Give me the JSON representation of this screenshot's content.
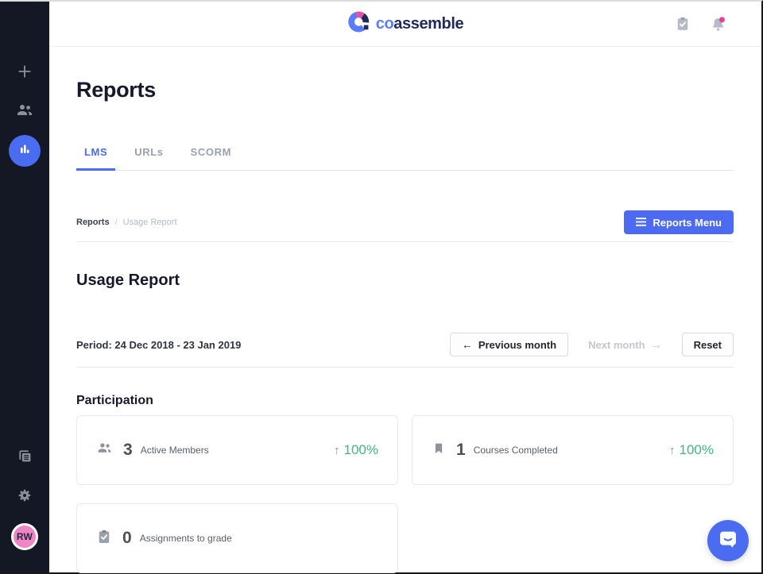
{
  "colors": {
    "accent_blue": "#4d6bf2",
    "logo_blue": "#5b7dfb",
    "navy": "#1f2a5c",
    "logo_pink": "#ed4d9e",
    "avatar_pink": "#ef85c5",
    "green": "#3fb884",
    "sidebar_bg": "#131824"
  },
  "sidebar": {
    "items": [
      {
        "name": "add",
        "icon": "plus-icon"
      },
      {
        "name": "members",
        "icon": "people-icon"
      },
      {
        "name": "reports",
        "icon": "bar-chart-icon",
        "active": true
      }
    ],
    "bottom_items": [
      {
        "name": "library",
        "icon": "stacked-pages-icon"
      },
      {
        "name": "settings",
        "icon": "gear-icon"
      }
    ],
    "avatar_initials": "RW"
  },
  "header": {
    "logo": {
      "co": "co",
      "assemble": "assemble"
    },
    "icons": [
      "clipboard-check-icon",
      "bell-icon"
    ],
    "bell_has_notification": true
  },
  "page": {
    "title": "Reports",
    "tabs": [
      {
        "label": "LMS",
        "active": true
      },
      {
        "label": "URLs",
        "active": false
      },
      {
        "label": "SCORM",
        "active": false
      }
    ],
    "breadcrumb": {
      "current_section": "Reports",
      "separator": "/",
      "current_page": "Usage Report"
    },
    "reports_menu_button": {
      "label": "Reports Menu"
    },
    "usage_report": {
      "title": "Usage Report",
      "period": "Period: 24 Dec 2018 - 23 Jan 2019",
      "controls": {
        "previous": {
          "arrow": "←",
          "label": "Previous month"
        },
        "next": {
          "label": "Next month",
          "arrow": "→",
          "disabled": true
        },
        "reset": {
          "label": "Reset"
        }
      }
    },
    "participation": {
      "title": "Participation",
      "cards": [
        {
          "icon": "people-icon",
          "value": "3",
          "label": "Active Members",
          "change_arrow": "↑",
          "change": "100%"
        },
        {
          "icon": "bookmark-icon",
          "value": "1",
          "label": "Courses Completed",
          "change_arrow": "↑",
          "change": "100%"
        },
        {
          "icon": "clipboard-check-icon",
          "value": "0",
          "label": "Assignments to grade",
          "change_arrow": "",
          "change": ""
        }
      ]
    }
  }
}
